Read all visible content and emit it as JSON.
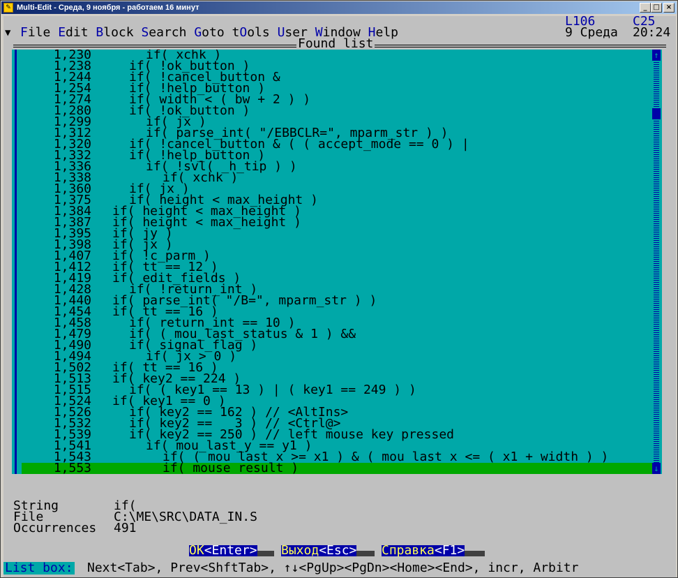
{
  "window": {
    "title": "Multi-Edit - Среда, 9 ноября - работаем 16 минут"
  },
  "indicators": {
    "line": "L106",
    "column": "C25",
    "date": "9 Среда",
    "time": "20:24"
  },
  "menu": [
    {
      "hotkey": "F",
      "rest": "ile"
    },
    {
      "hotkey": "E",
      "rest": "dit"
    },
    {
      "hotkey": "B",
      "rest": "lock"
    },
    {
      "hotkey": "S",
      "rest": "earch"
    },
    {
      "hotkey": "G",
      "rest": "oto"
    },
    {
      "pre": "t",
      "hotkey": "O",
      "rest": "ols"
    },
    {
      "hotkey": "U",
      "rest": "ser"
    },
    {
      "hotkey": "W",
      "rest": "indow"
    },
    {
      "hotkey": "H",
      "rest": "elp"
    }
  ],
  "dialog": {
    "title": "Found list"
  },
  "found_list": [
    {
      "line": "1,230",
      "code": "  if( xchk )"
    },
    {
      "line": "1,238",
      "code": "if( !ok_button )"
    },
    {
      "line": "1,244",
      "code": "if( !cancel_button &"
    },
    {
      "line": "1,254",
      "code": "if( !help_button )"
    },
    {
      "line": "1,274",
      "code": "if( width < ( bw + 2 ) )"
    },
    {
      "line": "1,280",
      "code": "if( !ok_button )"
    },
    {
      "line": "1,299",
      "code": "  if( jx )"
    },
    {
      "line": "1,312",
      "code": "  if( parse_int( \"/EBBCLR=\", mparm_str ) )"
    },
    {
      "line": "1,320",
      "code": "if( !cancel_button & ( ( accept_mode == 0 ) |"
    },
    {
      "line": "1,332",
      "code": "if( !help_button )"
    },
    {
      "line": "1,336",
      "code": "  if( !svl( _h_tip ) )"
    },
    {
      "line": "1,338",
      "code": "    if( xchk )"
    },
    {
      "line": "1,360",
      "code": "if( jx )"
    },
    {
      "line": "1,375",
      "code": "if( height < max_height )"
    },
    {
      "line": "1,384",
      "code": "if( height < max_height )"
    },
    {
      "line": "1,387",
      "code": "if( height < max_height )"
    },
    {
      "line": "1,395",
      "code": "if( jy )"
    },
    {
      "line": "1,398",
      "code": "if( jx )"
    },
    {
      "line": "1,407",
      "code": "if( !c_parm )"
    },
    {
      "line": "1,412",
      "code": "if( tt == 12 )"
    },
    {
      "line": "1,419",
      "code": "if( edit_fields )"
    },
    {
      "line": "1,428",
      "code": "  if( !return_int )"
    },
    {
      "line": "1,440",
      "code": "if( parse_int( \"/B=\", mparm_str ) )"
    },
    {
      "line": "1,454",
      "code": "if( tt == 16 )"
    },
    {
      "line": "1,458",
      "code": "  if( return_int == 10 )"
    },
    {
      "line": "1,479",
      "code": "  if( ( mou_last_status & 1 ) &&"
    },
    {
      "line": "1,490",
      "code": "  if( signal_flag )"
    },
    {
      "line": "1,494",
      "code": "    if( jx > 0 )"
    },
    {
      "line": "1,502",
      "code": "if( tt == 16 )"
    },
    {
      "line": "1,513",
      "code": "if( key2 == 224 )"
    },
    {
      "line": "1,515",
      "code": "  if( ( key1 == 13 ) | ( key1 == 249 ) )"
    },
    {
      "line": "1,524",
      "code": "if( key1 == 0 )"
    },
    {
      "line": "1,526",
      "code": "  if( key2 == 162 ) // <AltIns>"
    },
    {
      "line": "1,532",
      "code": "  if( key2 ==   3 ) // <Ctrl@>"
    },
    {
      "line": "1,539",
      "code": "  if( key2 == 250 ) // left mouse key pressed"
    },
    {
      "line": "1,541",
      "code": "    if( mou_last_y == y1 )"
    },
    {
      "line": "1,543",
      "code": "      if( ( mou_last_x >= x1 ) & ( mou_last_x <= ( x1 + width ) )"
    },
    {
      "line": "1,553",
      "code": "      if( mouse_result )"
    }
  ],
  "found_list_indent": [
    2,
    1,
    1,
    1,
    1,
    1,
    2,
    2,
    1,
    1,
    2,
    3,
    1,
    1,
    0,
    0,
    0,
    0,
    0,
    0,
    0,
    1,
    0,
    0,
    1,
    1,
    1,
    2,
    0,
    0,
    1,
    0,
    1,
    1,
    1,
    2,
    3,
    3
  ],
  "info": {
    "string_label": "String",
    "string_value": "if(",
    "file_label": "File",
    "file_value": "C:\\ME\\SRC\\DATA_IN.S",
    "occ_label": "Occurrences",
    "occ_value": "491"
  },
  "buttons": {
    "ok": {
      "hotkey": "OK",
      "rest": "<Enter>"
    },
    "exit": {
      "hotkey": "Выход",
      "rest": "<Esc>"
    },
    "help": {
      "hotkey": "Справка",
      "rest": "<F1>"
    }
  },
  "status": {
    "tag": "List box:",
    "text": "Next<Tab>, Prev<ShftTab>, ↑↓<PgUp><PgDn><Home><End>, incr, Arbitr"
  },
  "colors": {
    "list_bg": "#00a8a8",
    "selection_bg": "#00a800",
    "button_bg": "#0000a8",
    "title_bar": "#0a246a"
  }
}
